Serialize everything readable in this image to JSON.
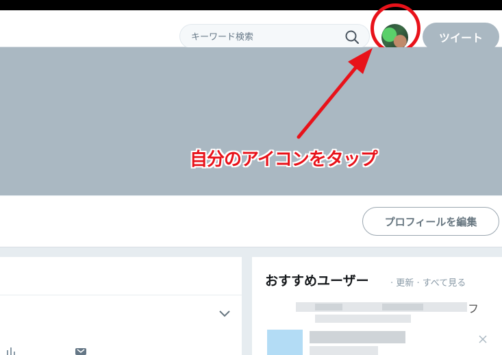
{
  "nav": {
    "search_placeholder": "キーワード検索",
    "tweet_label": "ツイート"
  },
  "annotation": {
    "text": "自分のアイコンをタップ",
    "color": "#e8121a"
  },
  "profile": {
    "edit_label": "プロフィールを編集"
  },
  "recommend": {
    "title": "おすすめユーザー",
    "sep1": "·",
    "refresh_label": "更新",
    "sep2": "·",
    "view_all_label": "すべて見る",
    "visible_fragment": "フ"
  },
  "colors": {
    "banner": "#aab8c2",
    "tweet_button_bg": "#aab8c2",
    "page_bg": "#e6ecf0"
  },
  "icons": [
    "search-icon",
    "avatar",
    "chevron-down-icon",
    "analytics-icon",
    "dismiss-icon"
  ]
}
